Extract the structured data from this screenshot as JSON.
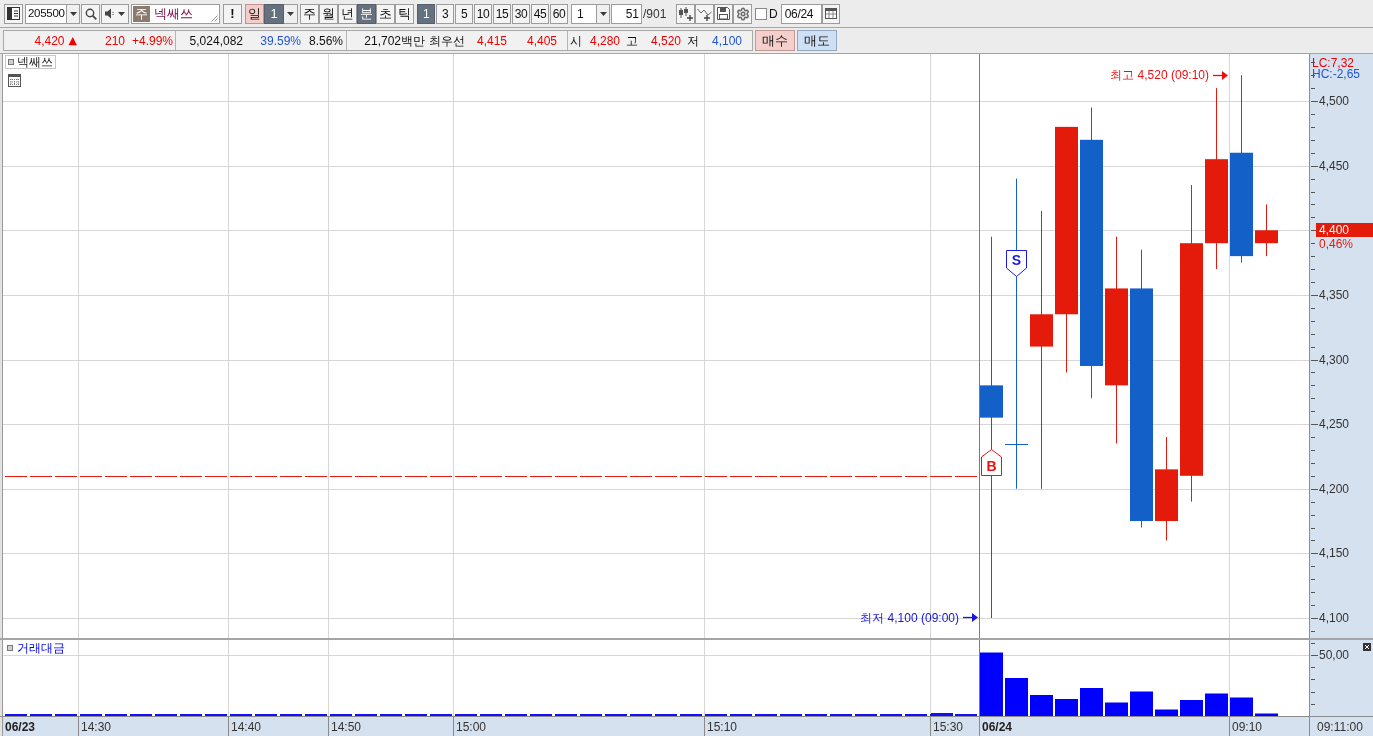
{
  "toolbar": {
    "code_field": {
      "value": "205500"
    },
    "name_field": {
      "tag": "주",
      "value": "넥쌔쓰"
    },
    "alert_button": {
      "label": "!"
    },
    "day_button": {
      "label": "일",
      "highlighted": true
    },
    "day_count": {
      "value": "1",
      "selected": true
    },
    "period_units": [
      {
        "label": "주",
        "selected": false
      },
      {
        "label": "월",
        "selected": false
      },
      {
        "label": "년",
        "selected": false
      },
      {
        "label": "분",
        "selected": true
      },
      {
        "label": "초",
        "selected": false
      },
      {
        "label": "틱",
        "selected": false
      }
    ],
    "intervals": [
      {
        "label": "1",
        "selected": true
      },
      {
        "label": "3",
        "selected": false
      },
      {
        "label": "5",
        "selected": false
      },
      {
        "label": "10",
        "selected": false
      },
      {
        "label": "15",
        "selected": false
      },
      {
        "label": "30",
        "selected": false
      },
      {
        "label": "45",
        "selected": false
      },
      {
        "label": "60",
        "selected": false
      }
    ],
    "interval_combo": {
      "value": "1"
    },
    "bar_count": {
      "value": "51",
      "total": "/901"
    },
    "date_checkbox": {
      "label": "D",
      "checked": false
    },
    "date_field": {
      "value": "06/24"
    }
  },
  "quote_bar": {
    "groups": [
      {
        "cells": [
          {
            "text": "4,420",
            "kind": "value",
            "color": "#f00000",
            "arrow": "▲"
          },
          {
            "text": "210",
            "kind": "value",
            "color": "#f00000"
          },
          {
            "text": "+4.99%",
            "kind": "value",
            "color": "#f00000"
          }
        ]
      },
      {
        "cells": [
          {
            "text": "5,024,082",
            "kind": "value"
          },
          {
            "text": "39.59%",
            "kind": "value",
            "color": "#1f55d8"
          },
          {
            "text": "8.56%",
            "kind": "value"
          }
        ]
      },
      {
        "cells": [
          {
            "text": "21,702백만",
            "kind": "value"
          },
          {
            "text": "최우선",
            "kind": "label"
          },
          {
            "text": "4,415",
            "kind": "value",
            "color": "#f00000"
          },
          {
            "text": "4,405",
            "kind": "value",
            "color": "#f00000"
          }
        ]
      },
      {
        "cells": [
          {
            "text": "시",
            "kind": "label"
          },
          {
            "text": "4,280",
            "kind": "value",
            "color": "#f00000"
          },
          {
            "text": "고",
            "kind": "label"
          },
          {
            "text": "4,520",
            "kind": "value",
            "color": "#f00000"
          },
          {
            "text": "저",
            "kind": "label"
          },
          {
            "text": "4,100",
            "kind": "value",
            "color": "#1f55d8"
          }
        ]
      }
    ],
    "trade_buttons": [
      {
        "label": "매수",
        "kind": "buy"
      },
      {
        "label": "매도",
        "kind": "sell"
      }
    ]
  },
  "price_panel": {
    "title": "넥쌔쓰",
    "axis_top": [
      {
        "text": "LC:7,32",
        "color": "#f00000"
      },
      {
        "text": "HC:-2,65",
        "color": "#1f55d8"
      }
    ],
    "y_axis_labels": [
      "4,500",
      "4,450",
      "4,350",
      "4,300",
      "4,250",
      "4,200",
      "4,150",
      "4,100"
    ],
    "current_price": {
      "value": "4,400",
      "change": "0,46%"
    },
    "notes": [
      {
        "kind": "high",
        "text": "최고 4,520 (09:10)"
      },
      {
        "kind": "low",
        "text": "최저 4,100 (09:00)"
      }
    ],
    "signals": [
      {
        "kind": "buy",
        "text": "B"
      },
      {
        "kind": "sell",
        "text": "S"
      }
    ]
  },
  "volume_panel": {
    "title": "거래대금",
    "scale_label": "50,00"
  },
  "x_axis": {
    "labels": [
      {
        "text": "06/23",
        "kind": "date"
      },
      {
        "text": "14:30",
        "kind": "time"
      },
      {
        "text": "14:40",
        "kind": "time"
      },
      {
        "text": "14:50",
        "kind": "time"
      },
      {
        "text": "15:00",
        "kind": "time"
      },
      {
        "text": "15:10",
        "kind": "time"
      },
      {
        "text": "15:30",
        "kind": "time"
      },
      {
        "text": "06/24",
        "kind": "date"
      },
      {
        "text": "09:10",
        "kind": "time"
      }
    ],
    "cursor_time": "09:11:00"
  }
}
